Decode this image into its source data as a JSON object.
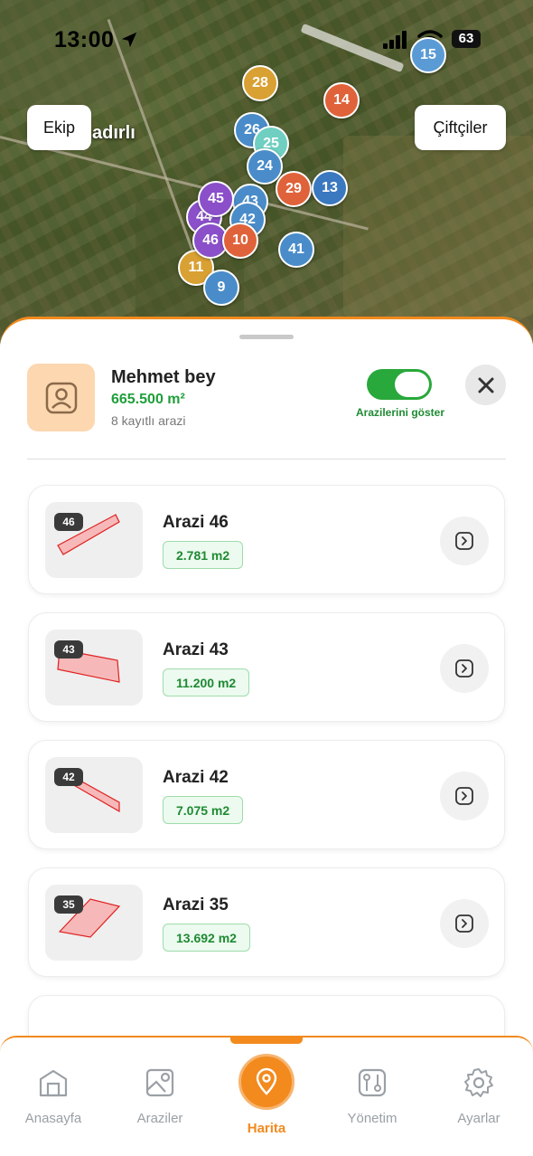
{
  "status_bar": {
    "time": "13:00",
    "battery": "63"
  },
  "map": {
    "team_button": "Ekip",
    "farmers_button": "Çiftçiler",
    "place_label": "adırlı",
    "pins": [
      {
        "label": "15",
        "color": "#5b9bd5"
      },
      {
        "label": "28",
        "color": "#d9a033"
      },
      {
        "label": "14",
        "color": "#e0623a"
      },
      {
        "label": "26",
        "color": "#4a8cc9"
      },
      {
        "label": "25",
        "color": "#6fcfc0"
      },
      {
        "label": "24",
        "color": "#4a8cc9"
      },
      {
        "label": "29",
        "color": "#e0623a"
      },
      {
        "label": "13",
        "color": "#3a78c0"
      },
      {
        "label": "45",
        "color": "#8a4fc9"
      },
      {
        "label": "43",
        "color": "#4a8cc9"
      },
      {
        "label": "44",
        "color": "#8a4fc9"
      },
      {
        "label": "42",
        "color": "#4a8cc9"
      },
      {
        "label": "46",
        "color": "#8a4fc9"
      },
      {
        "label": "10",
        "color": "#e0623a"
      },
      {
        "label": "41",
        "color": "#4a8cc9"
      },
      {
        "label": "11",
        "color": "#d9a033"
      },
      {
        "label": "9",
        "color": "#4a8cc9"
      }
    ]
  },
  "farmer": {
    "name": "Mehmet bey",
    "total_area": "665.500 m²",
    "parcel_count": "8 kayıtlı arazi",
    "toggle_label": "Arazilerini göster",
    "toggle_on": true
  },
  "parcels": [
    {
      "badge": "46",
      "name": "Arazi 46",
      "area": "2.781 m2"
    },
    {
      "badge": "43",
      "name": "Arazi 43",
      "area": "11.200 m2"
    },
    {
      "badge": "42",
      "name": "Arazi 42",
      "area": "7.075 m2"
    },
    {
      "badge": "35",
      "name": "Arazi 35",
      "area": "13.692 m2"
    }
  ],
  "tabs": {
    "home": "Anasayfa",
    "fields": "Araziler",
    "map": "Harita",
    "management": "Yönetim",
    "settings": "Ayarlar"
  },
  "colors": {
    "accent": "#f28a1e",
    "success": "#1f9e3a",
    "toggle_on": "#29a83b",
    "parcel_outline": "#e02020",
    "parcel_fill": "#f6b8b8"
  }
}
